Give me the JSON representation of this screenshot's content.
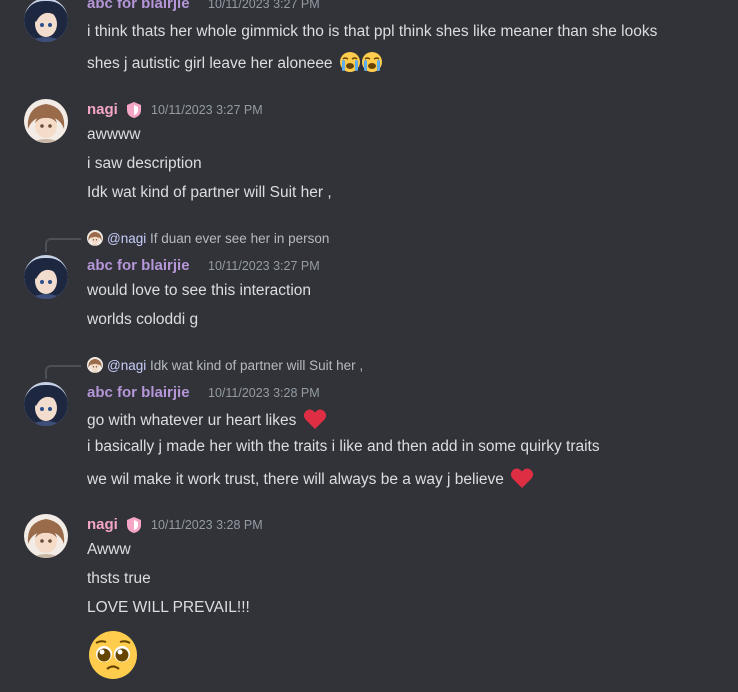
{
  "colors": {
    "bg": "#313338",
    "user_abc": "#b596d8",
    "user_nagi": "#f5a6c7",
    "timestamp": "#949ba4",
    "text": "#dbdee1",
    "heart": "#e0242f"
  },
  "groups": [
    {
      "username": "abc for blairjie",
      "timestamp": "10/11/2023 3:27 PM",
      "lines": [
        "i think thats her whole gimmick tho is that ppl think shes like meaner than she looks",
        "shes j autistic girl leave her aloneee"
      ],
      "emojis": [
        "loudly-crying-face",
        "loudly-crying-face"
      ]
    },
    {
      "username": "nagi",
      "timestamp": "10/11/2023 3:27 PM",
      "lines": [
        "awwww",
        "i saw description",
        "Idk wat kind of partner will Suit her ,"
      ]
    },
    {
      "reply": {
        "mention": "@nagi",
        "text": "If duan ever see her in person"
      },
      "username": "abc for blairjie",
      "timestamp": "10/11/2023 3:27 PM",
      "lines": [
        "would love to see this interaction",
        "worlds coloddi g"
      ]
    },
    {
      "reply": {
        "mention": "@nagi",
        "text": "Idk wat kind of partner will Suit her ,"
      },
      "username": "abc for blairjie",
      "timestamp": "10/11/2023 3:28 PM",
      "lines": [
        "go with whatever ur heart likes",
        "i basically j made her with the traits i like and then add in some quirky traits",
        "we wil make it work trust, there will always be a way j believe"
      ],
      "emojis": [
        "red-heart",
        "red-heart"
      ]
    },
    {
      "username": "nagi",
      "timestamp": "10/11/2023 3:28 PM",
      "lines": [
        "Awww",
        "thsts true",
        "LOVE WILL PREVAIL!!!"
      ],
      "emojis": [
        "pleading-face"
      ]
    }
  ]
}
